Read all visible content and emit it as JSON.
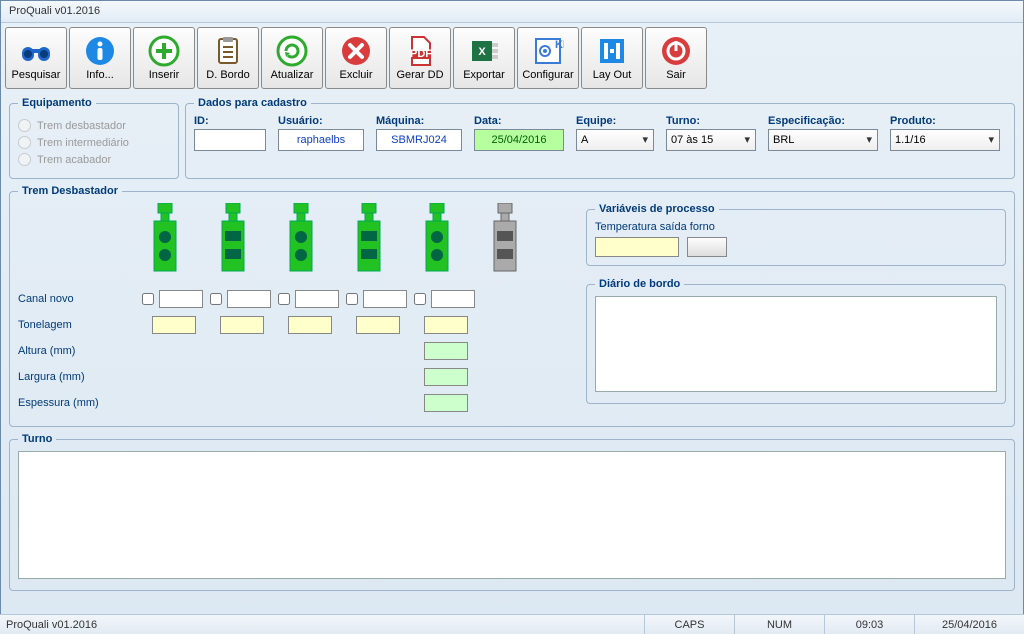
{
  "title": "ProQuali v01.2016",
  "toolbar": [
    {
      "name": "pesquisar",
      "label": "Pesquisar"
    },
    {
      "name": "info",
      "label": "Info..."
    },
    {
      "name": "inserir",
      "label": "Inserir"
    },
    {
      "name": "dbordo",
      "label": "D. Bordo"
    },
    {
      "name": "atualizar",
      "label": "Atualizar"
    },
    {
      "name": "excluir",
      "label": "Excluir"
    },
    {
      "name": "gerardd",
      "label": "Gerar DD"
    },
    {
      "name": "exportar",
      "label": "Exportar"
    },
    {
      "name": "configurar",
      "label": "Configurar"
    },
    {
      "name": "layout",
      "label": "Lay Out"
    },
    {
      "name": "sair",
      "label": "Sair"
    }
  ],
  "equip": {
    "legend": "Equipamento",
    "r1": "Trem desbastador",
    "r2": "Trem intermediário",
    "r3": "Trem acabador"
  },
  "dados": {
    "legend": "Dados para cadastro",
    "id": {
      "label": "ID:",
      "value": ""
    },
    "usuario": {
      "label": "Usuário:",
      "value": "raphaelbs"
    },
    "maquina": {
      "label": "Máquina:",
      "value": "SBMRJ024"
    },
    "data": {
      "label": "Data:",
      "value": "25/04/2016"
    },
    "equipe": {
      "label": "Equipe:",
      "value": "A"
    },
    "turno": {
      "label": "Turno:",
      "value": "07 às 15"
    },
    "espec": {
      "label": "Especificação:",
      "value": "BRL"
    },
    "produto": {
      "label": "Produto:",
      "value": "1.1/16"
    }
  },
  "trem": {
    "legend": "Trem Desbastador",
    "rows": {
      "canal": "Canal novo",
      "ton": "Tonelagem",
      "alt": "Altura (mm)",
      "larg": "Largura (mm)",
      "esp": "Espessura (mm)"
    },
    "vars": {
      "legend": "Variáveis de processo",
      "templabel": "Temperatura saída forno"
    },
    "diario": {
      "legend": "Diário de bordo"
    }
  },
  "turno": {
    "legend": "Turno"
  },
  "status": {
    "app": "ProQuali v01.2016",
    "caps": "CAPS",
    "num": "NUM",
    "time": "09:03",
    "date": "25/04/2016"
  }
}
